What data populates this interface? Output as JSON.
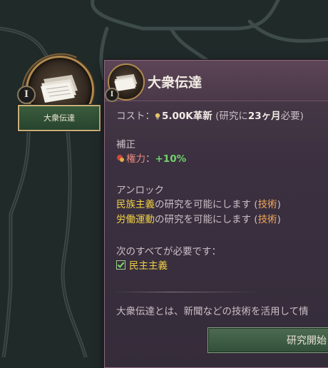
{
  "node": {
    "tier": "I",
    "label": "大衆伝達",
    "icon": "newspaper-icon"
  },
  "tooltip": {
    "tier": "I",
    "title": "大衆伝達",
    "icon": "newspaper-icon",
    "cost": {
      "prefix": "コスト：",
      "icon": "lightbulb-icon",
      "amount": "5.00K革新",
      "open_paren": " (研究に",
      "months": "23ヶ月",
      "suffix": "必要)"
    },
    "modifiers": {
      "heading": "補正",
      "items": [
        {
          "icon": "power-icon",
          "label": "権力",
          "sep": "：",
          "value": "+10%"
        }
      ]
    },
    "unlocks": {
      "heading": "アンロック",
      "items": [
        {
          "name": "民族主義",
          "text": "の研究を可能にします (",
          "tag": "技術",
          "close": ")"
        },
        {
          "name": "労働運動",
          "text": "の研究を可能にします (",
          "tag": "技術",
          "close": ")"
        }
      ]
    },
    "requirements": {
      "heading": "次のすべてが必要です：",
      "items": [
        {
          "label": "民主主義",
          "met": true
        }
      ]
    },
    "description": "大衆伝達とは、新聞などの技術を活用して情",
    "research_button": "研究開始"
  },
  "colors": {
    "background": "#202a29",
    "tooltip": "#3b3040",
    "node_label": "#2f4f35",
    "gold_border": "#b08a4e",
    "positive": "#6fd16a",
    "highlight": "#f2d246",
    "tag": "#f0a65a"
  }
}
